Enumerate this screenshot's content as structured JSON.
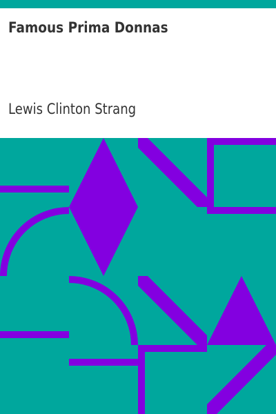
{
  "cover": {
    "title": "Famous Prima Donnas",
    "author": "Lewis Clinton Strang"
  },
  "colors": {
    "teal": "#00a79d",
    "purple": "#8300e0",
    "white": "#ffffff",
    "text": "#333333"
  }
}
